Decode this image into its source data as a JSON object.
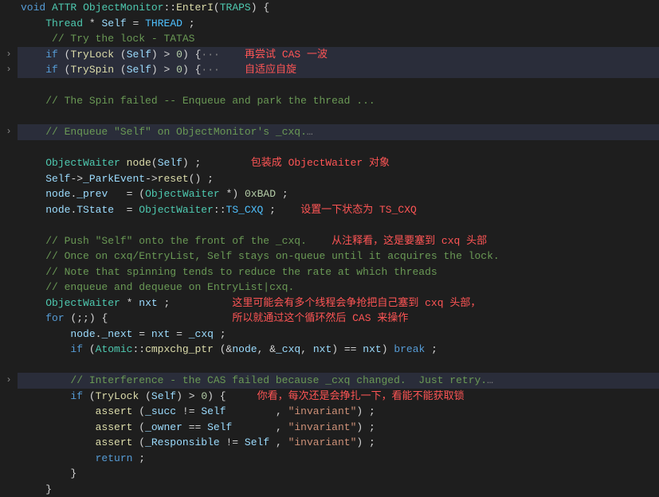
{
  "code": {
    "l1": "void ATTR ObjectMonitor::EnterI(TRAPS) {",
    "l2": "    Thread * Self = THREAD ;",
    "l3": "     // Try the lock - TATAS",
    "l4": "    if (TryLock (Self) > 0) {",
    "l5": "    if (TrySpin (Self) > 0) {",
    "l6": "",
    "l7": "    // The Spin failed -- Enqueue and park the thread ...",
    "l8": "",
    "l9": "    // Enqueue \"Self\" on ObjectMonitor's _cxq.",
    "l10": "",
    "l11": "    ObjectWaiter node(Self) ;",
    "l12": "    Self->_ParkEvent->reset() ;",
    "l13": "    node._prev   = (ObjectWaiter *) 0xBAD ;",
    "l14": "    node.TState  = ObjectWaiter::TS_CXQ ;",
    "l15": "",
    "l16": "    // Push \"Self\" onto the front of the _cxq.",
    "l17": "    // Once on cxq/EntryList, Self stays on-queue until it acquires the lock.",
    "l18": "    // Note that spinning tends to reduce the rate at which threads",
    "l19": "    // enqueue and dequeue on EntryList|cxq.",
    "l20": "    ObjectWaiter * nxt ;",
    "l21": "    for (;;) {",
    "l22": "        node._next = nxt = _cxq ;",
    "l23": "        if (Atomic::cmpxchg_ptr (&node, &_cxq, nxt) == nxt) break ;",
    "l24": "",
    "l25": "        // Interference - the CAS failed because _cxq changed.  Just retry.",
    "l26": "        if (TryLock (Self) > 0) {",
    "l27": "            assert (_succ != Self        , \"invariant\") ;",
    "l28": "            assert (_owner == Self       , \"invariant\") ;",
    "l29": "            assert (_Responsible != Self , \"invariant\") ;",
    "l30": "            return ;",
    "l31": "        }",
    "l32": "    }"
  },
  "annotations": {
    "a1": "再尝试 CAS 一波",
    "a2": "自适应自旋",
    "a3": "包装成 ObjectWaiter 对象",
    "a4": "设置一下状态为 TS_CXQ",
    "a5": "从注释看，这是要塞到 cxq 头部",
    "a6": "这里可能会有多个线程会争抢把自己塞到 cxq 头部，",
    "a7": "所以就通过这个循环然后 CAS 来操作",
    "a8": "你看，每次还是会挣扎一下，看能不能获取锁"
  },
  "fold_marker": "›",
  "ellipsis": "…",
  "fold_dots": "···"
}
